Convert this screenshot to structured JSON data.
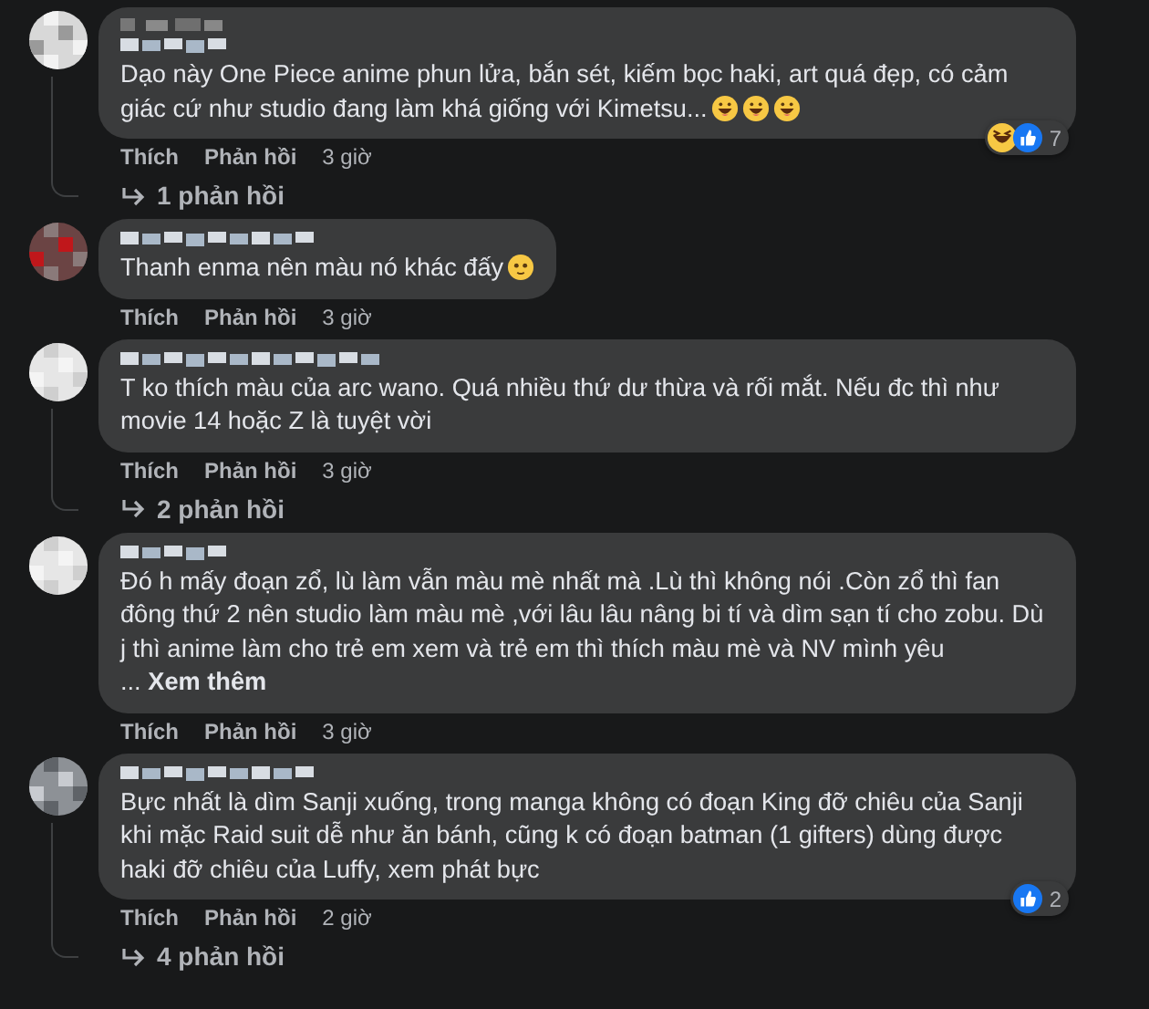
{
  "comments": [
    {
      "author_badge": true,
      "text": "Dạo này One Piece anime phun lửa, bắn sét, kiếm bọc haki, art quá đẹp, có cảm giác cứ như studio đang làm khá giống với Kimetsu...",
      "actions": [
        "Thích",
        "Phản hồi"
      ],
      "time": "3 giờ",
      "reactions": {
        "count": "7"
      },
      "replies": "1 phản hồi"
    },
    {
      "author_badge": false,
      "text": "Thanh enma nên màu nó khác đấy",
      "actions": [
        "Thích",
        "Phản hồi"
      ],
      "time": "3 giờ"
    },
    {
      "author_badge": false,
      "text": "T ko thích màu của arc wano. Quá nhiều thứ dư thừa và rối mắt. Nếu đc thì như movie 14 hoặc Z là tuyệt vời",
      "actions": [
        "Thích",
        "Phản hồi"
      ],
      "time": "3 giờ",
      "replies": "2 phản hồi"
    },
    {
      "author_badge": false,
      "text": "Đó h mấy đoạn zổ, lù làm vẫn màu mè nhất mà .Lù thì không nói .Còn zổ thì fan đông thứ 2 nên studio làm màu mè ,với lâu lâu nâng bi tí và dìm sạn tí cho zobu. Dù j thì anime làm cho trẻ em xem và trẻ em thì thích màu mè và NV mình yêu ...",
      "see_more": "Xem thêm",
      "actions": [
        "Thích",
        "Phản hồi"
      ],
      "time": "3 giờ"
    },
    {
      "author_badge": false,
      "text": "Bực nhất là dìm Sanji xuống, trong manga không có đoạn King đỡ chiêu của Sanji khi mặc Raid suit dễ như ăn bánh, cũng k có đoạn batman (1 gifters) dùng được haki đỡ chiêu của Luffy, xem phát bực",
      "actions": [
        "Thích",
        "Phản hồi"
      ],
      "time": "2 giờ",
      "reactions": {
        "count": "2"
      },
      "replies": "4 phản hồi"
    }
  ]
}
